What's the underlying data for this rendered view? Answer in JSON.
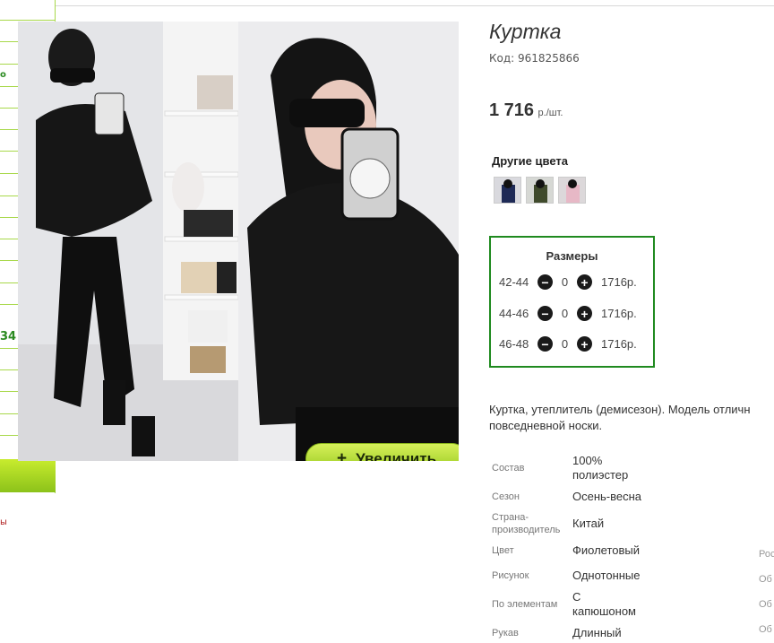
{
  "sidebar": {
    "fragments": [
      "о",
      "34"
    ],
    "bottom_text": "ы"
  },
  "gallery": {
    "zoom_button": {
      "icon": "plus-icon",
      "label": "Увеличить"
    }
  },
  "product": {
    "title": "Куртка",
    "code": "Код: 961825866",
    "price": {
      "amount": "1 716",
      "unit": "р./шт."
    },
    "other_colors": {
      "title": "Другие цвета",
      "swatches": [
        "navy",
        "olive",
        "pink"
      ]
    },
    "sizes": {
      "title": "Размеры",
      "rows": [
        {
          "size": "42-44",
          "qty": "0",
          "price": "1716р."
        },
        {
          "size": "44-46",
          "qty": "0",
          "price": "1716р."
        },
        {
          "size": "46-48",
          "qty": "0",
          "price": "1716р."
        }
      ]
    },
    "description": "Куртка, утеплитель (демисезон). Модель отличн\nповседневной носки.",
    "properties": [
      {
        "key": "Состав",
        "value": "100%\nполиэстер"
      },
      {
        "key": "Сезон",
        "value": "Осень-весна"
      },
      {
        "key": "Страна-\nпроизводитель",
        "value": "Китай"
      },
      {
        "key": "Цвет",
        "value": "Фиолетовый"
      },
      {
        "key": "Рисунок",
        "value": "Однотонные"
      },
      {
        "key": "По элементам",
        "value": "С\nкапюшоном"
      },
      {
        "key": "Рукав",
        "value": "Длинный"
      }
    ],
    "right_fragments": [
      "Рос",
      "Об",
      "Об",
      "Об",
      "Об"
    ]
  },
  "colors": {
    "accent_green": "#1f8a1f",
    "button_green": "#96c81e"
  }
}
